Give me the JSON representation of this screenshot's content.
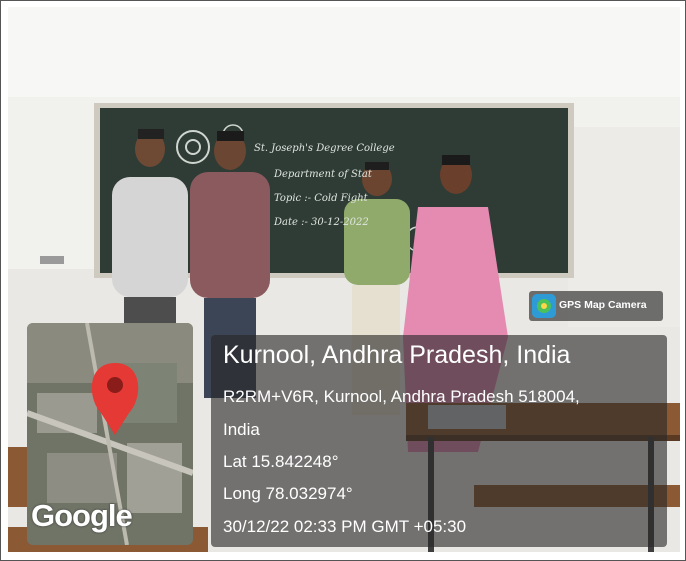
{
  "board_text": {
    "line1": "St. Joseph's Degree College",
    "line2": "Department of Stat",
    "line3": "Topic :- Cold Fight",
    "line4": "Date :- 30-12-2022"
  },
  "app_badge": {
    "label": "GPS Map Camera",
    "icon": "camera-pin-icon"
  },
  "location": {
    "place": "Kurnool, Andhra Pradesh, India",
    "address_line1": "R2RM+V6R, Kurnool, Andhra Pradesh 518004,",
    "address_line2": "India",
    "lat": "Lat 15.842248°",
    "long": "Long 78.032974°",
    "timestamp": "30/12/22 02:33 PM GMT +05:30"
  },
  "map": {
    "provider": "Google",
    "pin_color": "#e53935"
  },
  "colors": {
    "board": "#2f3b35",
    "overlay": "#2a2a2a",
    "saree": "#e58ab0"
  }
}
